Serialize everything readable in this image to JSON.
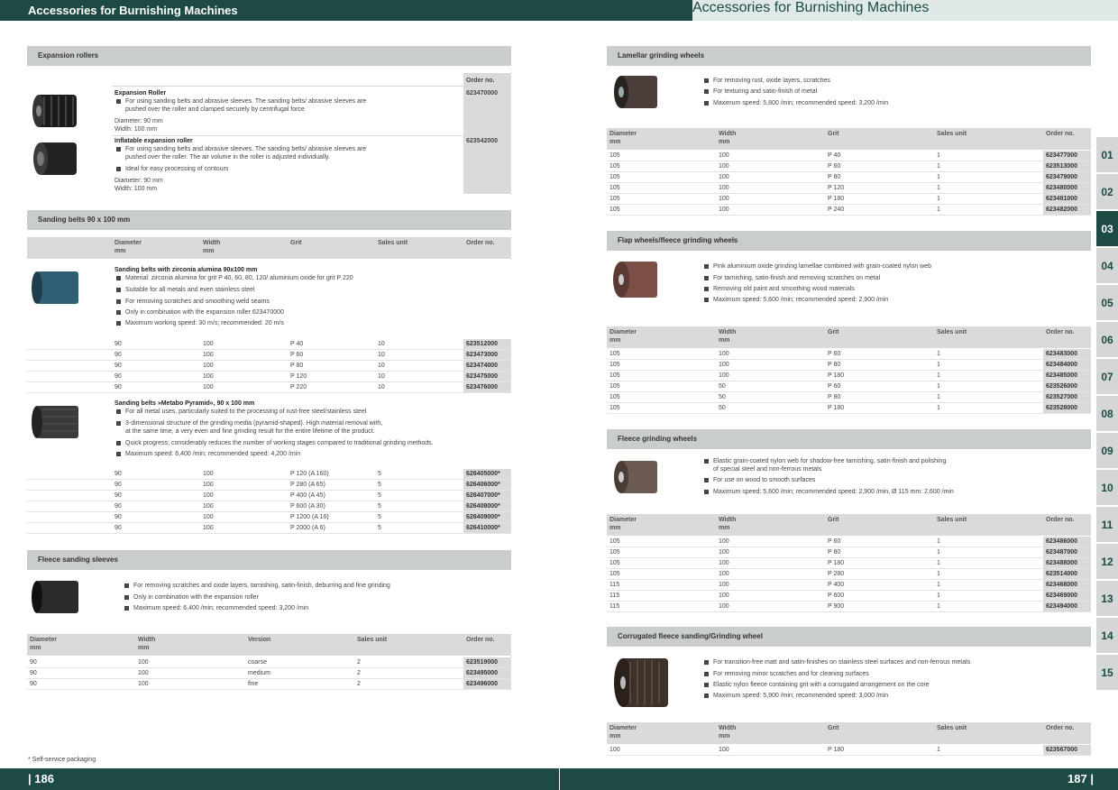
{
  "header": {
    "title_left": "Accessories for Burnishing Machines",
    "title_right": "Accessories for Burnishing Machines"
  },
  "footer": {
    "page_left": "| 186",
    "page_right": "187 |",
    "note": "* Self-service packaging"
  },
  "tabs": [
    "01",
    "02",
    "03",
    "04",
    "05",
    "06",
    "07",
    "08",
    "09",
    "10",
    "11",
    "12",
    "13",
    "14",
    "15"
  ],
  "active_tab": "03",
  "cols": {
    "diameter": "Diameter",
    "mm": "mm",
    "width": "Width",
    "grit": "Grit",
    "sales": "Sales unit",
    "order": "Order no.",
    "version": "Version"
  },
  "expansion": {
    "title": "Expansion rollers",
    "p1": {
      "name": "Expansion Roller",
      "b1a": "For using sanding belts and abrasive sleeves. The sanding belts/ abrasive sleeves are",
      "b1b": "pushed over the roller and clamped securely by centrifugal force",
      "d": "Diameter: 90 mm",
      "w": "Width: 100 mm",
      "order": "623470000"
    },
    "p2": {
      "name": "Inflatable expansion roller",
      "b1a": "For using sanding belts and abrasive sleeves. The sanding belts/ abrasive sleeves are",
      "b1b": "pushed over the roller. The air volume in the roller is adjusted individually.",
      "b2": "Ideal for easy processing of contours",
      "d": "Diameter: 90 mm",
      "w": "Width: 100 mm",
      "order": "623542000"
    }
  },
  "belts": {
    "title": "Sanding belts 90 x 100 mm",
    "z": {
      "name": "Sanding belts with zirconia alumina 90x100 mm",
      "b": [
        "Material: zirconia alumina for grit P 40, 60, 80, 120/ aluminium oxide for grit P 220",
        "Suitable for all metals and even stainless steel",
        "For removing scratches and smoothing weld seams",
        "Only in combination with the expansion roller 623470000",
        "Maximum working speed: 30 m/s; recommended: 20 m/s"
      ],
      "rows": [
        [
          "90",
          "100",
          "P 40",
          "10",
          "623512000"
        ],
        [
          "90",
          "100",
          "P 60",
          "10",
          "623473000"
        ],
        [
          "90",
          "100",
          "P 80",
          "10",
          "623474000"
        ],
        [
          "90",
          "100",
          "P 120",
          "10",
          "623475000"
        ],
        [
          "90",
          "100",
          "P 220",
          "10",
          "623476000"
        ]
      ]
    },
    "p": {
      "name": "Sanding belts »Metabo Pyramid«, 90 x 100 mm",
      "b": [
        "For all metal uses, particularly suited to the processing of rust-free steel/stainless steel",
        "3-dimensional structure of the grinding media (pyramid-shaped). High material removal with,",
        "at the same time, a very even and fine grinding result for the entire lifetime of the product.",
        "Quick progress; considerably reduces the number of working stages compared to traditional grinding methods.",
        "Maximum speed: 6,400 /min; recommended speed: 4,200 /min"
      ],
      "rows": [
        [
          "90",
          "100",
          "P 120 (A 160)",
          "5",
          "626405000*"
        ],
        [
          "90",
          "100",
          "P 280 (A 65)",
          "5",
          "626406000*"
        ],
        [
          "90",
          "100",
          "P 400 (A 45)",
          "5",
          "626407000*"
        ],
        [
          "90",
          "100",
          "P 600 (A 30)",
          "5",
          "626408000*"
        ],
        [
          "90",
          "100",
          "P 1200 (A 16)",
          "5",
          "626409000*"
        ],
        [
          "90",
          "100",
          "P 2000 (A 6)",
          "5",
          "626410000*"
        ]
      ]
    }
  },
  "fleece_sleeves": {
    "title": "Fleece sanding sleeves",
    "b": [
      "For removing scratches and oxide layers, tarnishing, satin-finish, deburring and fine grinding",
      "Only in combination with the expansion roller",
      "Maximum speed: 6,400 /min; recommended speed: 3,200 /min"
    ],
    "rows": [
      [
        "90",
        "100",
        "coarse",
        "2",
        "623519000"
      ],
      [
        "90",
        "100",
        "medium",
        "2",
        "623495000"
      ],
      [
        "90",
        "100",
        "fine",
        "2",
        "623496000"
      ]
    ]
  },
  "lamellar": {
    "title": "Lamellar grinding wheels",
    "b": [
      "For removing rust, oxide layers, scratches",
      "For texturing and satin-finish of metal",
      "Maximum speed: 5,800 /min; recommended speed: 3,200 /min"
    ],
    "rows": [
      [
        "105",
        "100",
        "P 40",
        "1",
        "623477000"
      ],
      [
        "105",
        "100",
        "P 60",
        "1",
        "623513000"
      ],
      [
        "105",
        "100",
        "P 80",
        "1",
        "623479000"
      ],
      [
        "105",
        "100",
        "P 120",
        "1",
        "623480000"
      ],
      [
        "105",
        "100",
        "P 180",
        "1",
        "623481000"
      ],
      [
        "105",
        "100",
        "P 240",
        "1",
        "623482000"
      ]
    ]
  },
  "flap": {
    "title": "Flap wheels/fleece grinding wheels",
    "b": [
      "Pink aluminium oxide grinding lamellae combined with grain-coated nylon web",
      "For tarnishing, satin-finish and removing scratches on metal",
      "Removing old paint and smoothing wood materials",
      "Maximum speed: 5,600 /min; recommended speed: 2,900 /min"
    ],
    "rows": [
      [
        "105",
        "100",
        "P 60",
        "1",
        "623483000"
      ],
      [
        "105",
        "100",
        "P 80",
        "1",
        "623484000"
      ],
      [
        "105",
        "100",
        "P 180",
        "1",
        "623485000"
      ],
      [
        "105",
        "50",
        "P 60",
        "1",
        "623526000"
      ],
      [
        "105",
        "50",
        "P 80",
        "1",
        "623527000"
      ],
      [
        "105",
        "50",
        "P 180",
        "1",
        "623528000"
      ]
    ]
  },
  "fleece": {
    "title": "Fleece grinding wheels",
    "b": [
      "Elastic grain-coated nylon web for shadow-free tarnishing, satin-finish and polishing",
      "of special steel and non-ferrous metals",
      "For use on wood to smooth surfaces",
      "Maximum speed: 5,600 /min; recommended speed: 2,900 /min, Ø 115 mm: 2,600 /min"
    ],
    "rows": [
      [
        "105",
        "100",
        "P 60",
        "1",
        "623486000"
      ],
      [
        "105",
        "100",
        "P 80",
        "1",
        "623487000"
      ],
      [
        "105",
        "100",
        "P 180",
        "1",
        "623488000"
      ],
      [
        "105",
        "100",
        "P 280",
        "1",
        "623514000"
      ],
      [
        "115",
        "100",
        "P 400",
        "1",
        "623468000"
      ],
      [
        "115",
        "100",
        "P 600",
        "1",
        "623469000"
      ],
      [
        "115",
        "100",
        "P 900",
        "1",
        "623494000"
      ]
    ]
  },
  "corrugated": {
    "title": "Corrugated fleece sanding/Grinding wheel",
    "b": [
      "For transition-free matt and satin-finishes on stainless steel surfaces and non-ferrous metals",
      "For removing minor scratches and for cleaning surfaces",
      "Elastic nylon fleece containing grit with a corrugated arrangement on the core",
      "Maximum speed: 5,900 /min; recommended speed: 3,000 /min"
    ],
    "rows": [
      [
        "100",
        "100",
        "P 180",
        "1",
        "623567000"
      ]
    ]
  }
}
